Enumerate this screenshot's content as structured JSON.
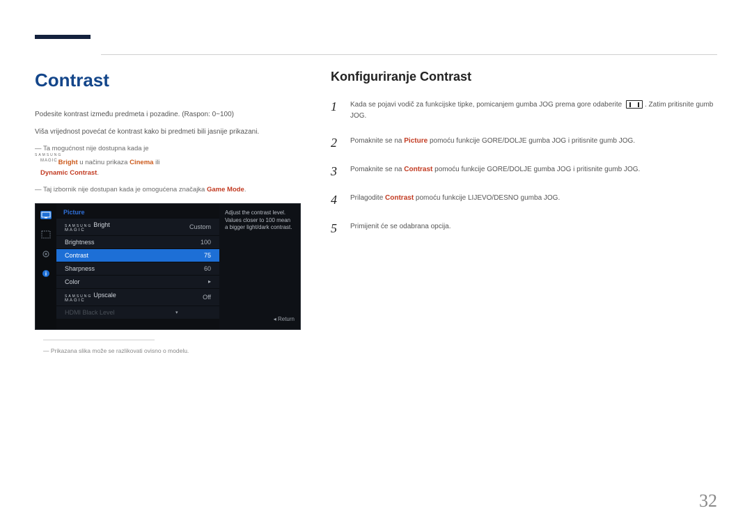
{
  "left": {
    "heading": "Contrast",
    "intro1": "Podesite kontrast između predmeta i pozadine. (Raspon: 0~100)",
    "intro2": "Viša vrijednost povećat će kontrast kako bi predmeti bili jasnije prikazani.",
    "note1_pre": "Ta mogućnost nije dostupna kada je ",
    "note1_magic_sams": "SAMSUNG",
    "note1_magic": "MAGIC",
    "note1_bright": "Bright",
    "note1_mid": " u načinu prikaza ",
    "note1_cinema": "Cinema",
    "note1_or": " ili ",
    "note1_dyn": "Dynamic Contrast",
    "note1_end": ".",
    "note2_pre": "Taj izbornik nije dostupan kada je omogućena značajka ",
    "note2_game": "Game Mode",
    "note2_end": ".",
    "caption": "Prikazana slika može se razlikovati ovisno o modelu."
  },
  "osd": {
    "header": "Picture",
    "rows": {
      "bright_label_sams": "SAMSUNG",
      "bright_label_magic": "MAGIC",
      "bright_label": "Bright",
      "bright_value": "Custom",
      "brightness_label": "Brightness",
      "brightness_value": "100",
      "contrast_label": "Contrast",
      "contrast_value": "75",
      "sharpness_label": "Sharpness",
      "sharpness_value": "60",
      "color_label": "Color",
      "upscale_label_sams": "SAMSUNG",
      "upscale_label_magic": "MAGIC",
      "upscale_label": "Upscale",
      "upscale_value": "Off",
      "hdmi_label": "HDMI Black Level"
    },
    "tooltip": "Adjust the contrast level. Values closer to 100 mean a bigger light/dark contrast.",
    "return": "Return"
  },
  "right": {
    "heading": "Konfiguriranje Contrast",
    "steps": {
      "s1_pre": "Kada se pojavi vodič za funkcijske tipke, pomicanjem gumba JOG prema gore odaberite ",
      "s1_post": ". Zatim pritisnite gumb JOG.",
      "s2_pre": "Pomaknite se na ",
      "s2_pic": "Picture",
      "s2_post": " pomoću funkcije GORE/DOLJE gumba JOG i pritisnite gumb JOG.",
      "s3_pre": "Pomaknite se na ",
      "s3_con": "Contrast",
      "s3_post": " pomoću funkcije GORE/DOLJE gumba JOG i pritisnite gumb JOG.",
      "s4_pre": "Prilagodite ",
      "s4_con": "Contrast",
      "s4_post": " pomoću funkcije LIJEVO/DESNO gumba JOG.",
      "s5": "Primijenit će se odabrana opcija."
    },
    "nums": {
      "n1": "1",
      "n2": "2",
      "n3": "3",
      "n4": "4",
      "n5": "5"
    }
  },
  "page_number": "32"
}
